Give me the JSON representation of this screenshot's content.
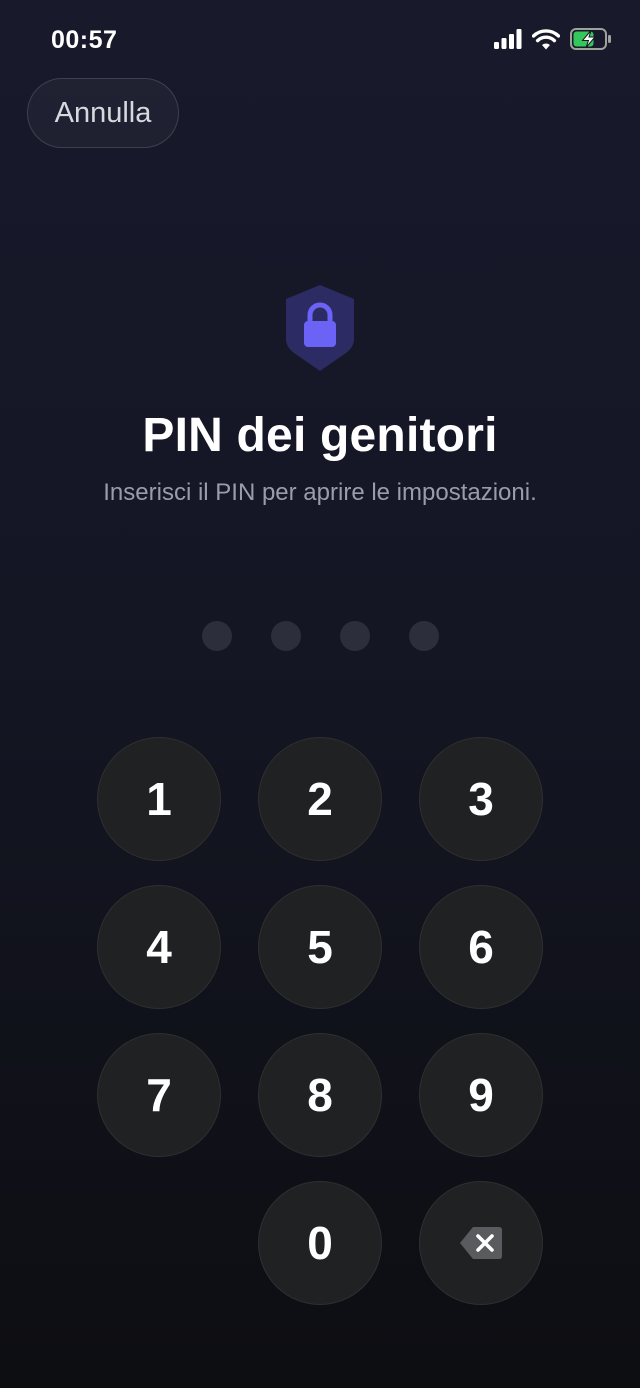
{
  "status_bar": {
    "time": "00:57",
    "icons": [
      "signal-icon",
      "wifi-icon",
      "battery-charging-icon"
    ],
    "battery_color": "#34c759"
  },
  "header": {
    "cancel_label": "Annulla",
    "icon": "lock-shield-icon",
    "title": "PIN dei genitori",
    "subtitle": "Inserisci il PIN per aprire le impostazioni."
  },
  "pin": {
    "length": 4,
    "entered": 0
  },
  "keypad": {
    "keys": [
      "1",
      "2",
      "3",
      "4",
      "5",
      "6",
      "7",
      "8",
      "9",
      "0"
    ],
    "backspace_icon": "backspace-icon"
  },
  "colors": {
    "accent": "#6b63f6",
    "shield": "#2c2b63",
    "background_top": "#181a2c",
    "background_bottom": "#0d0e12",
    "key_fill": "#202122"
  }
}
